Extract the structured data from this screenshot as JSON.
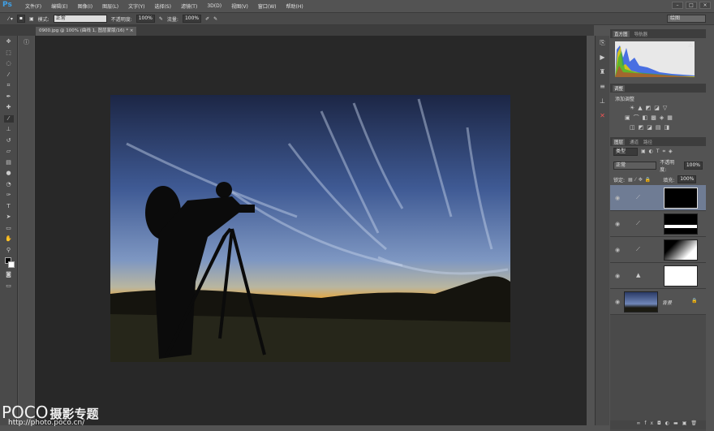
{
  "app": {
    "logo": "Ps",
    "menus": [
      "文件(F)",
      "编辑(E)",
      "图像(I)",
      "图层(L)",
      "文字(Y)",
      "选择(S)",
      "滤镜(T)",
      "3D(D)",
      "视图(V)",
      "窗口(W)",
      "帮助(H)"
    ],
    "window_buttons": [
      "–",
      "□",
      "×"
    ]
  },
  "options": {
    "mode_label": "模式:",
    "mode_value": "正常",
    "opacity_label": "不透明度:",
    "opacity_value": "100%",
    "flow_label": "流量:",
    "flow_value": "100%",
    "workspace": "绘图"
  },
  "document": {
    "tab_title": "0900.jpg @ 100% (曲线 1, 图层蒙版/16) *",
    "tab_close": "×"
  },
  "tools": [
    "move",
    "marquee",
    "lasso",
    "quick-select",
    "crop",
    "eyedropper",
    "healing",
    "brush",
    "stamp",
    "history-brush",
    "eraser",
    "gradient",
    "blur",
    "dodge",
    "pen",
    "type",
    "path-select",
    "shape",
    "hand",
    "zoom"
  ],
  "panels": {
    "histogram": {
      "tabs": [
        "直方图",
        "导航器"
      ],
      "warning": "⚠"
    },
    "adjustments": {
      "tab": "调整",
      "title": "添加调整"
    },
    "layers": {
      "tabs": [
        "图层",
        "通道",
        "路径"
      ],
      "filter": "类型",
      "blend_mode": "正常",
      "opacity_label": "不透明度:",
      "opacity_value": "100%",
      "lock_label": "锁定:",
      "fill_label": "填充:",
      "fill_value": "100%",
      "items": [
        {
          "type": "curves",
          "mask": "black",
          "selected": true
        },
        {
          "type": "curves",
          "mask": "horizon"
        },
        {
          "type": "curves",
          "mask": "gradient-silhouette"
        },
        {
          "type": "levels",
          "mask": "white"
        },
        {
          "type": "background",
          "name": "背景"
        }
      ],
      "footer_icons": [
        "link",
        "fx",
        "mask",
        "adjustment",
        "group",
        "new",
        "delete"
      ]
    }
  },
  "watermark": {
    "brand": "POCO",
    "text": "摄影专题",
    "url": "http://photo.poco.cn/"
  }
}
